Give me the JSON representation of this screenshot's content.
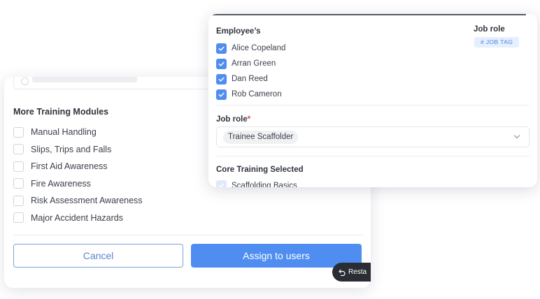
{
  "modules_card": {
    "title": "More Training Modules",
    "items": [
      {
        "label": "Manual Handling",
        "checked": false
      },
      {
        "label": "Slips, Trips and Falls",
        "checked": false
      },
      {
        "label": "First Aid Awareness",
        "checked": false
      },
      {
        "label": "Fire Awareness",
        "checked": false
      },
      {
        "label": "Risk Assessment Awareness",
        "checked": false
      },
      {
        "label": "Major Accident Hazards",
        "checked": false
      }
    ],
    "cancel_label": "Cancel",
    "assign_label": "Assign to users"
  },
  "restart": {
    "label": "Resta",
    "icon": "undo-icon"
  },
  "employees_card": {
    "title": "Employee’s",
    "employees": [
      {
        "name": "Alice Copeland",
        "checked": true
      },
      {
        "name": "Arran Green",
        "checked": true
      },
      {
        "name": "Dan Reed",
        "checked": true
      },
      {
        "name": "Rob Cameron",
        "checked": true
      }
    ],
    "job_role_heading": "Job role",
    "job_tag": "# JOB TAG",
    "job_role_field_label": "Job role",
    "required_marker": "*",
    "job_role_value": "Trainee Scaffolder",
    "core_title": "Core Training Selected",
    "core_items": [
      {
        "label": "Scaffolding Basics",
        "checked": true
      }
    ]
  },
  "colors": {
    "accent": "#4f8ef0",
    "checkbox_checked": "#4f8ef0",
    "tag_bg": "#e6effd",
    "tag_text": "#4a84e0",
    "required": "#e5484d",
    "pill_bg": "#2a2d33"
  }
}
